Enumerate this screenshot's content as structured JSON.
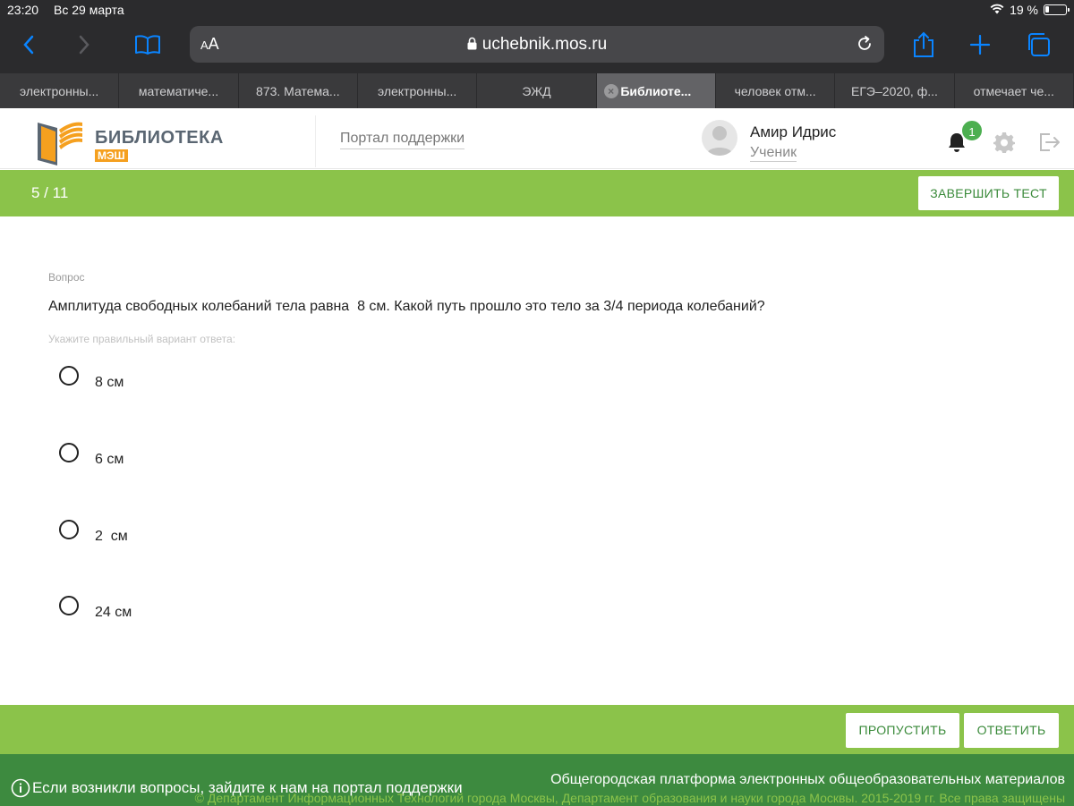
{
  "status_bar": {
    "time": "23:20",
    "date": "Вс 29 марта",
    "battery": "19 %",
    "battery_level": 0.19
  },
  "browser": {
    "url": "uchebnik.mos.ru",
    "aa_small": "A",
    "aa_large": "A",
    "tabs": [
      {
        "label": "электронны..."
      },
      {
        "label": "математиче..."
      },
      {
        "label": "873. Матема..."
      },
      {
        "label": "электронны..."
      },
      {
        "label": "ЭЖД"
      },
      {
        "label": "Библиоте...",
        "active": true
      },
      {
        "label": "человек отм..."
      },
      {
        "label": "ЕГЭ–2020, ф..."
      },
      {
        "label": "отмечает че..."
      }
    ]
  },
  "header": {
    "logo_title": "БИБЛИОТЕКА",
    "logo_sub": "МЭШ",
    "support_link": "Портал поддержки",
    "user_name": "Амир Идрис",
    "user_role": "Ученик",
    "notifications": "1"
  },
  "test": {
    "counter": "5 / 11",
    "finish_label": "ЗАВЕРШИТЬ ТЕСТ",
    "question_label": "Вопрос",
    "question_text": "Амплитуда свободных колебаний тела равна  8 см. Какой путь прошло это тело за 3/4 периода колебаний?",
    "hint": "Укажите правильный вариант ответа:",
    "options": [
      {
        "label": "8 см"
      },
      {
        "label": "6 см"
      },
      {
        "label": "2  см"
      },
      {
        "label": "24 см"
      }
    ],
    "skip_label": "ПРОПУСТИТЬ",
    "answer_label": "ОТВЕТИТЬ"
  },
  "footer": {
    "help_text": "Если возникли вопросы, зайдите к нам на портал поддержки",
    "platform_text": "Общегородская платформа электронных общеобразовательных материалов",
    "copyright": "© Департамент Информационных Технологий города Москвы, Департамент образования и науки города Москвы. 2015-2019 гг. Все права защищены"
  },
  "colors": {
    "green": "#8bc34a",
    "dark_green": "#3d8a3f",
    "accent_blue": "#0a84ff",
    "logo_orange": "#f5a01f"
  }
}
